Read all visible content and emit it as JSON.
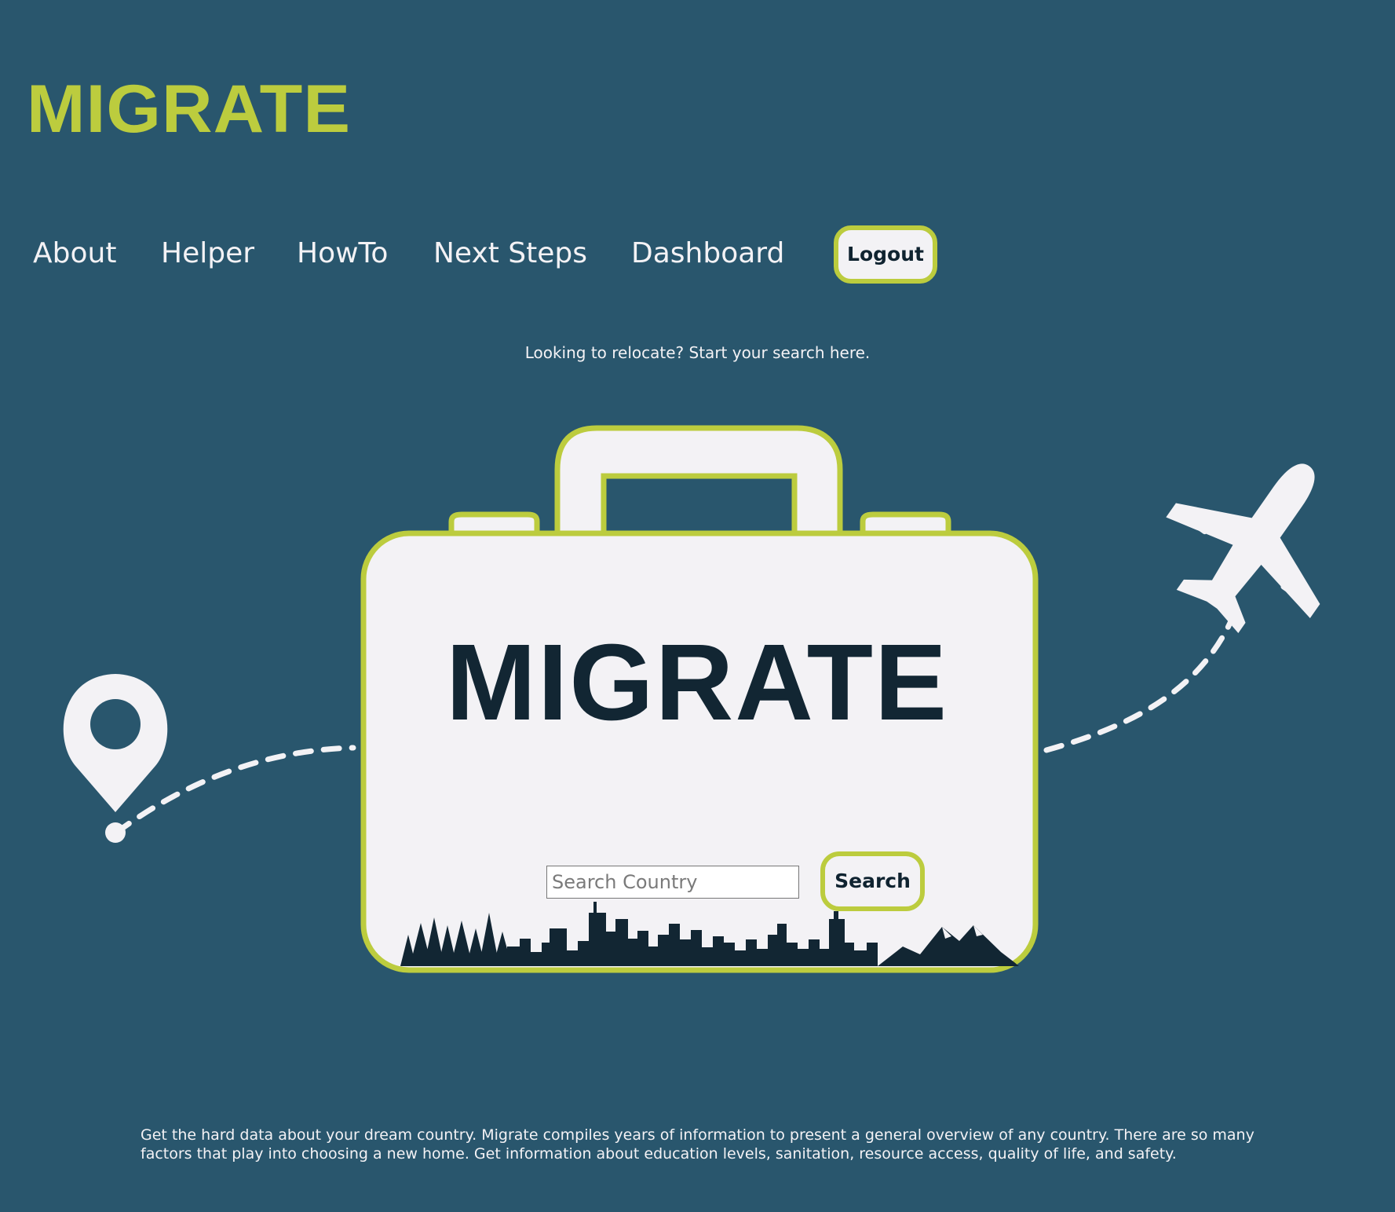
{
  "brand": {
    "logo": "MIGRATE",
    "accent_color": "#bccc3e",
    "background_color": "#29566d"
  },
  "nav": {
    "items": [
      {
        "label": "About"
      },
      {
        "label": "Helper"
      },
      {
        "label": "HowTo"
      },
      {
        "label": "Next Steps"
      },
      {
        "label": "Dashboard"
      }
    ],
    "logout_label": "Logout"
  },
  "hero": {
    "tagline": "Looking to relocate? Start your search here.",
    "suitcase_title": "MIGRATE",
    "search": {
      "placeholder": "Search Country",
      "value": "",
      "button_label": "Search"
    }
  },
  "icons": {
    "location_pin": "map-pin-icon",
    "airplane": "airplane-icon",
    "skyline": "city-skyline-graphic"
  },
  "description": "Get the hard data about your dream country. Migrate compiles years of information to present a general overview of any country. There are so many factors that play into choosing a new home. Get information about education levels, sanitation, resource access, quality of life, and safety."
}
